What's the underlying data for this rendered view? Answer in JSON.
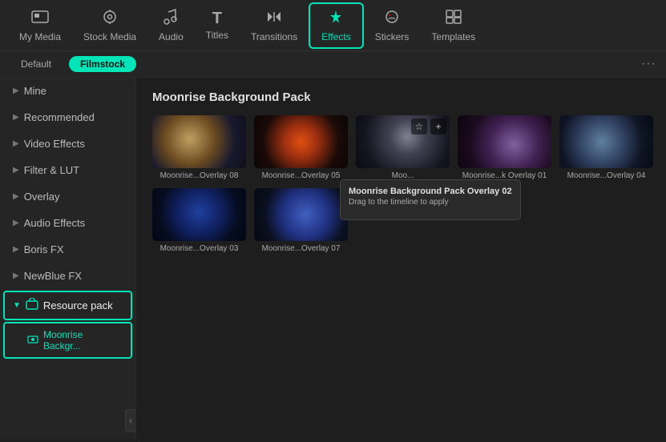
{
  "nav": {
    "items": [
      {
        "id": "my-media",
        "label": "My Media",
        "icon": "🎬"
      },
      {
        "id": "stock-media",
        "label": "Stock Media",
        "icon": "📷"
      },
      {
        "id": "audio",
        "label": "Audio",
        "icon": "🎵"
      },
      {
        "id": "titles",
        "label": "Titles",
        "icon": "T"
      },
      {
        "id": "transitions",
        "label": "Transitions",
        "icon": "↔"
      },
      {
        "id": "effects",
        "label": "Effects",
        "icon": "✦",
        "active": true
      },
      {
        "id": "stickers",
        "label": "Stickers",
        "icon": "🔵"
      },
      {
        "id": "templates",
        "label": "Templates",
        "icon": "⊞"
      }
    ]
  },
  "filter_bar": {
    "filters": [
      {
        "id": "default",
        "label": "Default"
      },
      {
        "id": "filmstock",
        "label": "Filmstock",
        "active": true
      }
    ],
    "more_label": "···"
  },
  "sidebar": {
    "items": [
      {
        "id": "mine",
        "label": "Mine"
      },
      {
        "id": "recommended",
        "label": "Recommended"
      },
      {
        "id": "video-effects",
        "label": "Video Effects"
      },
      {
        "id": "filter-lut",
        "label": "Filter & LUT"
      },
      {
        "id": "overlay",
        "label": "Overlay"
      },
      {
        "id": "audio-effects",
        "label": "Audio Effects"
      },
      {
        "id": "boris-fx",
        "label": "Boris FX"
      },
      {
        "id": "newblue-fx",
        "label": "NewBlue FX"
      }
    ],
    "resource_pack": {
      "label": "Resource pack",
      "sub_item": "Moonrise Backgr..."
    },
    "collapse_icon": "‹"
  },
  "content": {
    "pack_title": "Moonrise Background Pack",
    "items": [
      {
        "id": "overlay-08",
        "label": "Moonrise...Overlay 08",
        "thumb_class": "moon-08"
      },
      {
        "id": "overlay-05",
        "label": "Moonrise...Overlay 05",
        "thumb_class": "moon-05"
      },
      {
        "id": "overlay-02",
        "label": "Moonrise...Overlay 02",
        "thumb_class": "moon-02",
        "tooltip": true,
        "tooltip_title": "Moonrise Background Pack Overlay 02",
        "tooltip_sub": "Drag to the timeline to apply",
        "label_short": "Moo..."
      },
      {
        "id": "overlay-01",
        "label": "Moonrise...k Overlay 01",
        "thumb_class": "moon-01"
      },
      {
        "id": "overlay-04",
        "label": "Moonrise...Overlay 04",
        "thumb_class": "moon-04"
      },
      {
        "id": "overlay-03",
        "label": "Moonrise...Overlay 03",
        "thumb_class": "moon-03"
      },
      {
        "id": "overlay-07",
        "label": "Moonrise...Overlay 07",
        "thumb_class": "moon-07"
      }
    ]
  }
}
